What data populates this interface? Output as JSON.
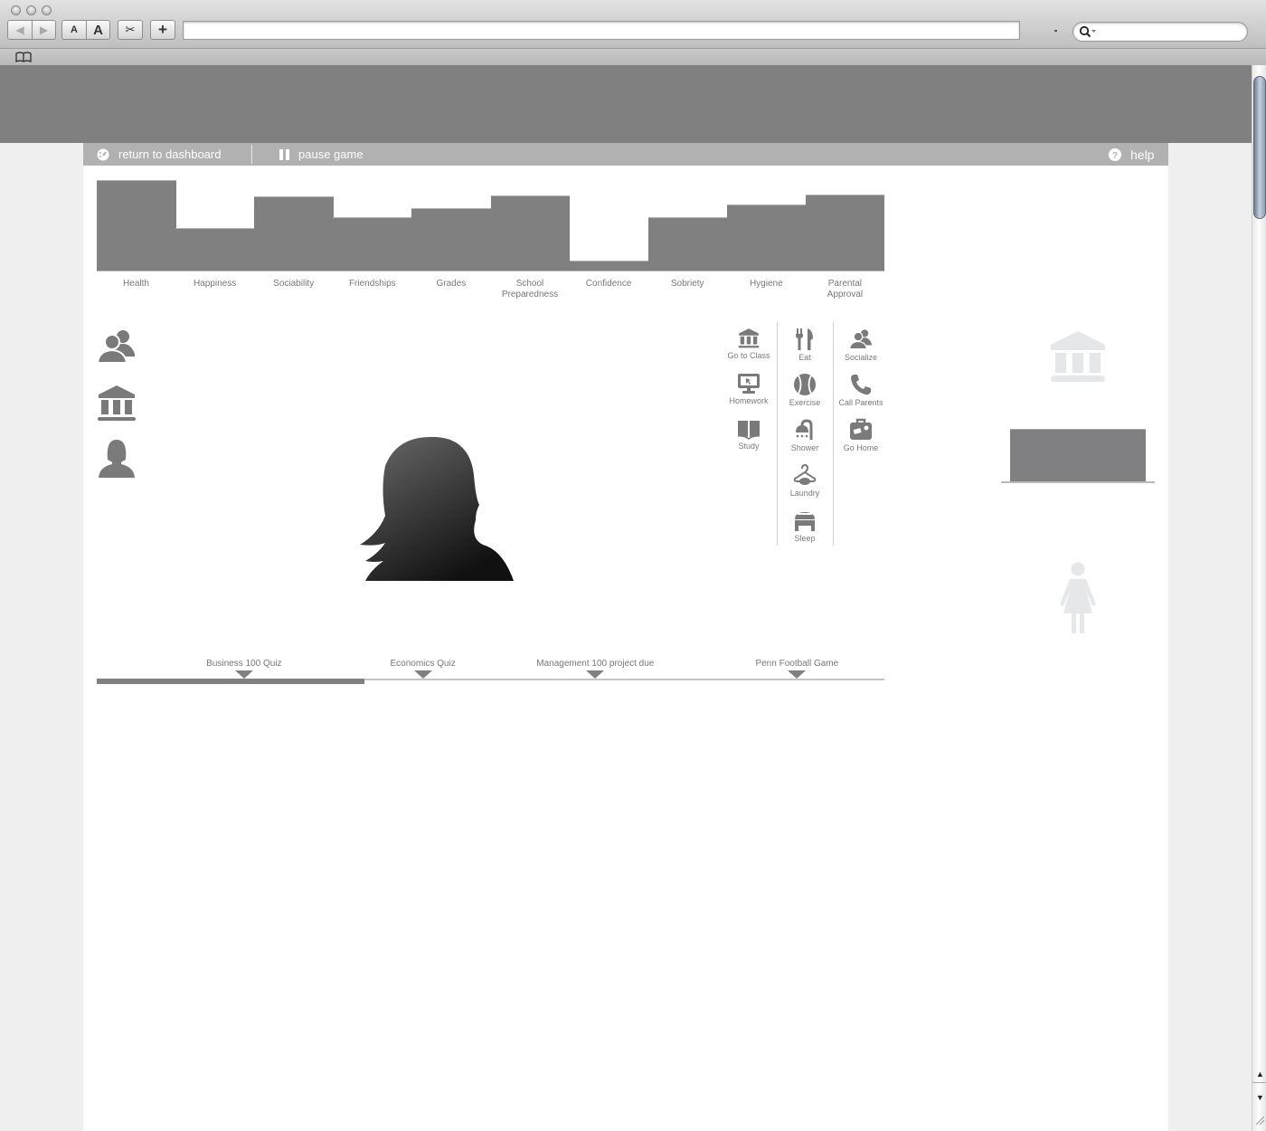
{
  "browser": {
    "url": "",
    "search_placeholder": "",
    "text_smaller": "A",
    "text_bigger": "A",
    "add_label": "+"
  },
  "navbar": {
    "dashboard_label": "return to dashboard",
    "pause_label": "pause game",
    "help_label": "help"
  },
  "stats": {
    "chart_data": {
      "type": "bar",
      "title": "",
      "xlabel": "",
      "ylabel": "",
      "ylim": [
        0,
        100
      ],
      "categories": [
        "Health",
        "Happiness",
        "Sociability",
        "Friendships",
        "Grades",
        "School Preparedness",
        "Confidence",
        "Sobriety",
        "Hygiene",
        "Parental Approval"
      ],
      "values": [
        100,
        47,
        82,
        59,
        69,
        83,
        11,
        59,
        73,
        84
      ]
    },
    "labels": [
      [
        "Health"
      ],
      [
        "Happiness"
      ],
      [
        "Sociability"
      ],
      [
        "Friendships"
      ],
      [
        "Grades"
      ],
      [
        "School",
        "Preparedness"
      ],
      [
        "Confidence"
      ],
      [
        "Sobriety"
      ],
      [
        "Hygiene"
      ],
      [
        "Parental",
        "Approval"
      ]
    ]
  },
  "left_icons": [
    "people-icon",
    "institution-icon",
    "female-avatar-icon"
  ],
  "actions": {
    "columns": [
      [
        {
          "label": "Go to Class",
          "icon": "institution-icon"
        },
        {
          "label": "Homework",
          "icon": "monitor-icon"
        },
        {
          "label": "Study",
          "icon": "book-icon"
        }
      ],
      [
        {
          "label": "Eat",
          "icon": "fork-knife-icon"
        },
        {
          "label": "Exercise",
          "icon": "ball-icon"
        },
        {
          "label": "Shower",
          "icon": "shower-icon"
        },
        {
          "label": "Laundry",
          "icon": "hanger-icon"
        },
        {
          "label": "Sleep",
          "icon": "bed-icon"
        }
      ],
      [
        {
          "label": "Socialize",
          "icon": "people-icon"
        },
        {
          "label": "Call Parents",
          "icon": "phone-icon"
        },
        {
          "label": "Go Home",
          "icon": "suitcase-icon"
        }
      ]
    ]
  },
  "location_panel": {
    "location_icon": "institution-icon",
    "meter_fraction": 1.0,
    "gender_icon": "female-figure-icon"
  },
  "timeline": {
    "progress_percent": 34,
    "events": [
      {
        "label": "Business 100 Quiz",
        "position_percent": 18.7
      },
      {
        "label": "Economics Quiz",
        "position_percent": 41.4
      },
      {
        "label": "Management 100 project due",
        "position_percent": 63.3
      },
      {
        "label": "Penn Football Game",
        "position_percent": 88.9
      }
    ]
  }
}
